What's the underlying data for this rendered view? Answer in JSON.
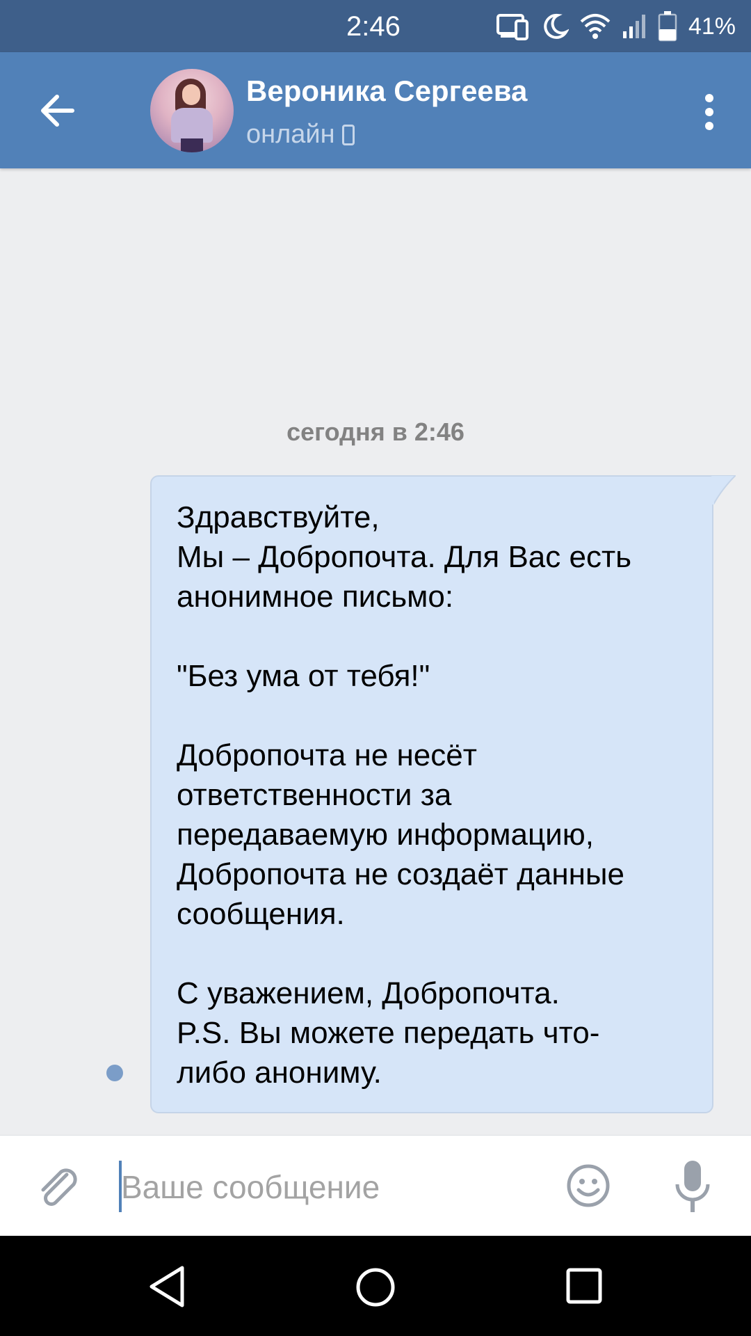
{
  "status_bar": {
    "time": "2:46",
    "battery": "41%",
    "icons": [
      "cast-icon",
      "moon-icon",
      "wifi-icon",
      "signal-icon",
      "battery-icon"
    ]
  },
  "header": {
    "contact_name": "Вероника Сергеева",
    "status": "онлайн",
    "colors": {
      "background": "#5181b8",
      "status_bar": "#3e5f8a"
    }
  },
  "conversation": {
    "date_separator": "сегодня в 2:46",
    "message": {
      "lines": [
        "Здравствуйте,",
        "Мы – Добропочта. Для Вас есть",
        "анонимное письмо:",
        "",
        "\"Без ума от тебя!\"",
        "",
        "Добропочта не несёт",
        "ответственности за",
        "передаваемую информацию,",
        "Добропочта не создаёт данные",
        "сообщения.",
        "",
        "С уважением, Добропочта.",
        "P.S. Вы можете передать что-",
        "либо анониму."
      ],
      "bubble_color": "#d6e5f8",
      "unread": true
    }
  },
  "composer": {
    "placeholder": "Ваше сообщение"
  }
}
